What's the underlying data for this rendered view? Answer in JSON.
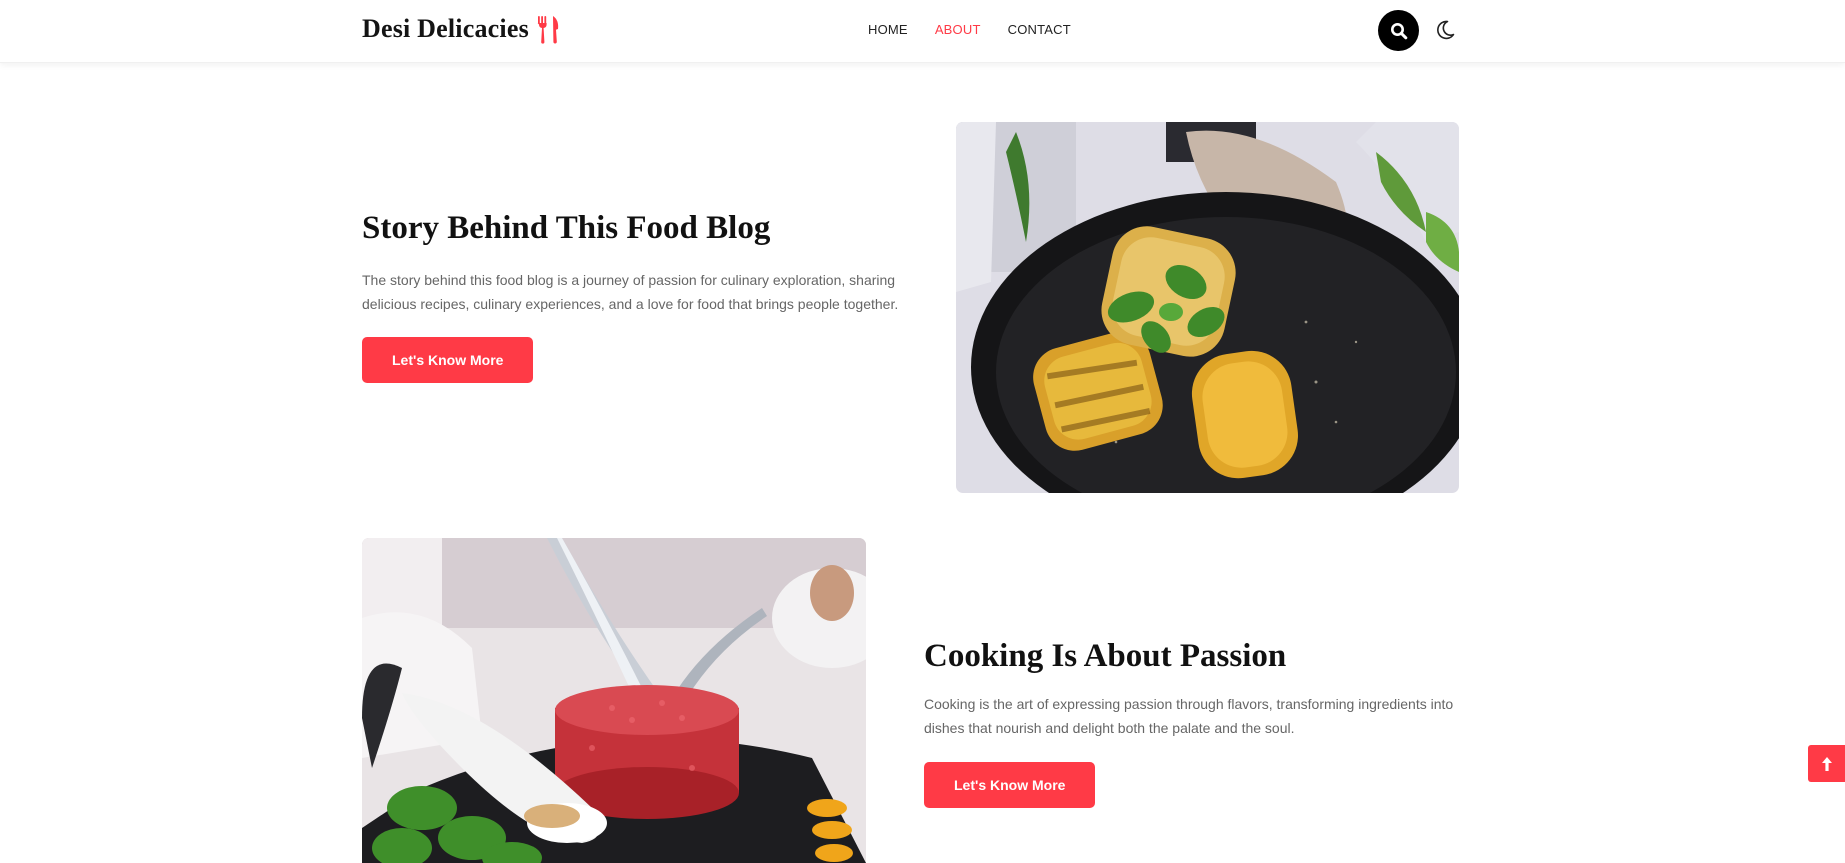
{
  "header": {
    "logo_text": "Desi Delicacies",
    "nav": [
      {
        "label": "HOME",
        "active": false
      },
      {
        "label": "ABOUT",
        "active": true
      },
      {
        "label": "CONTACT",
        "active": false
      }
    ],
    "icons": {
      "logo": "fork-knife-icon",
      "search": "search-icon",
      "theme": "moon-icon"
    }
  },
  "story": {
    "title": "Story Behind This Food Blog",
    "text": "The story behind this food blog is a journey of passion for culinary exploration, sharing delicious recipes, culinary experiences, and a love for food that brings people together.",
    "button": "Let's Know More"
  },
  "passion": {
    "title": "Cooking Is About Passion",
    "text": "Cooking is the art of expressing passion through flavors, transforming ingredients into dishes that nourish and delight both the palate and the soul.",
    "button": "Let's Know More"
  },
  "scroll_top": {
    "icon": "arrow-up-icon"
  },
  "colors": {
    "accent": "#ff3a46",
    "text": "#111111",
    "muted": "#666666"
  }
}
